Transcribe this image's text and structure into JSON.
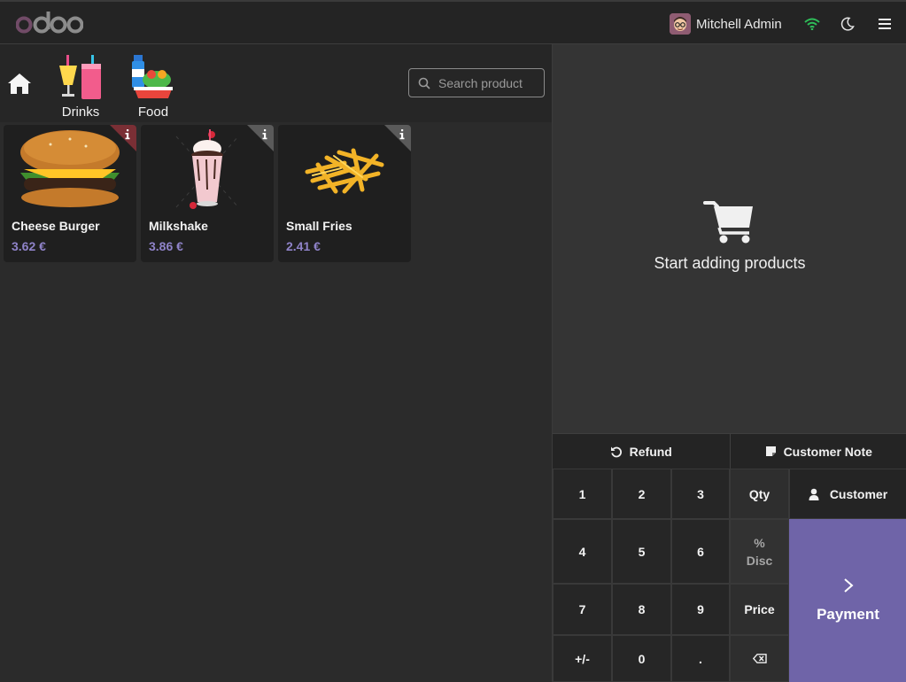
{
  "navbar": {
    "logo": "odoo",
    "user_name": "Mitchell Admin",
    "icons": [
      "wifi-icon",
      "moon-icon",
      "hamburger-menu-icon"
    ],
    "wifi_color": "#2ebd59"
  },
  "categories": [
    {
      "label": "Drinks",
      "icon": "drinks-icon"
    },
    {
      "label": "Food",
      "icon": "food-icon"
    }
  ],
  "search": {
    "placeholder": "Search product"
  },
  "products": [
    {
      "name": "Cheese Burger",
      "price": "3.62 €",
      "icon": "burger-image"
    },
    {
      "name": "Milkshake",
      "price": "3.86 €",
      "icon": "milkshake-image"
    },
    {
      "name": "Small Fries",
      "price": "2.41 €",
      "icon": "fries-image"
    }
  ],
  "order": {
    "empty_message": "Start adding products"
  },
  "actions": {
    "refund": "Refund",
    "customer_note": "Customer Note"
  },
  "numpad": {
    "keys": [
      "1",
      "2",
      "3",
      "4",
      "5",
      "6",
      "7",
      "8",
      "9",
      "+/-",
      "0",
      "."
    ],
    "qty": "Qty",
    "disc_symbol": "%",
    "disc": "Disc",
    "price": "Price",
    "customer": "Customer",
    "payment": "Payment"
  },
  "colors": {
    "accent": "#714B67",
    "price": "#8f83c9",
    "payment": "#6f64a8"
  }
}
